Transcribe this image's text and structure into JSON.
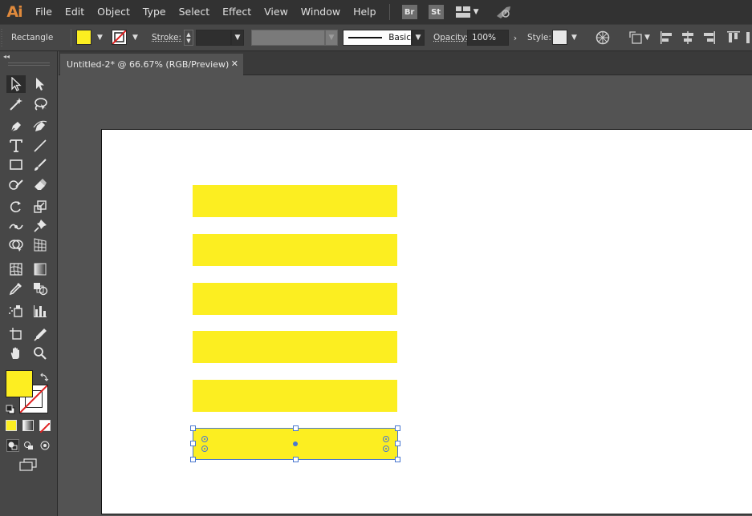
{
  "app": {
    "logo": "Ai",
    "menu": [
      "File",
      "Edit",
      "Object",
      "Type",
      "Select",
      "Effect",
      "View",
      "Window",
      "Help"
    ],
    "badges": [
      "Br",
      "St"
    ]
  },
  "control": {
    "selection_type": "Rectangle",
    "fill_color": "#fcee21",
    "stroke_label": "Stroke:",
    "stroke_weight": "",
    "brush_style": "Basic",
    "opacity_label": "Opacity:",
    "opacity_value": "100%",
    "style_label": "Style:"
  },
  "document": {
    "tab_title": "Untitled-2* @ 66.67% (RGB/Preview)",
    "close_glyph": "✕"
  },
  "tools": {
    "fill_color": "#fcee21",
    "stroke_color": "none"
  },
  "artwork": {
    "rect_color": "#fcee21",
    "rectangles": 6,
    "selected_index": 5
  },
  "colors": {
    "menubar_bg": "#323232",
    "panel_bg": "#474747",
    "canvas_bg": "#535353",
    "selection": "#4a78d0"
  }
}
